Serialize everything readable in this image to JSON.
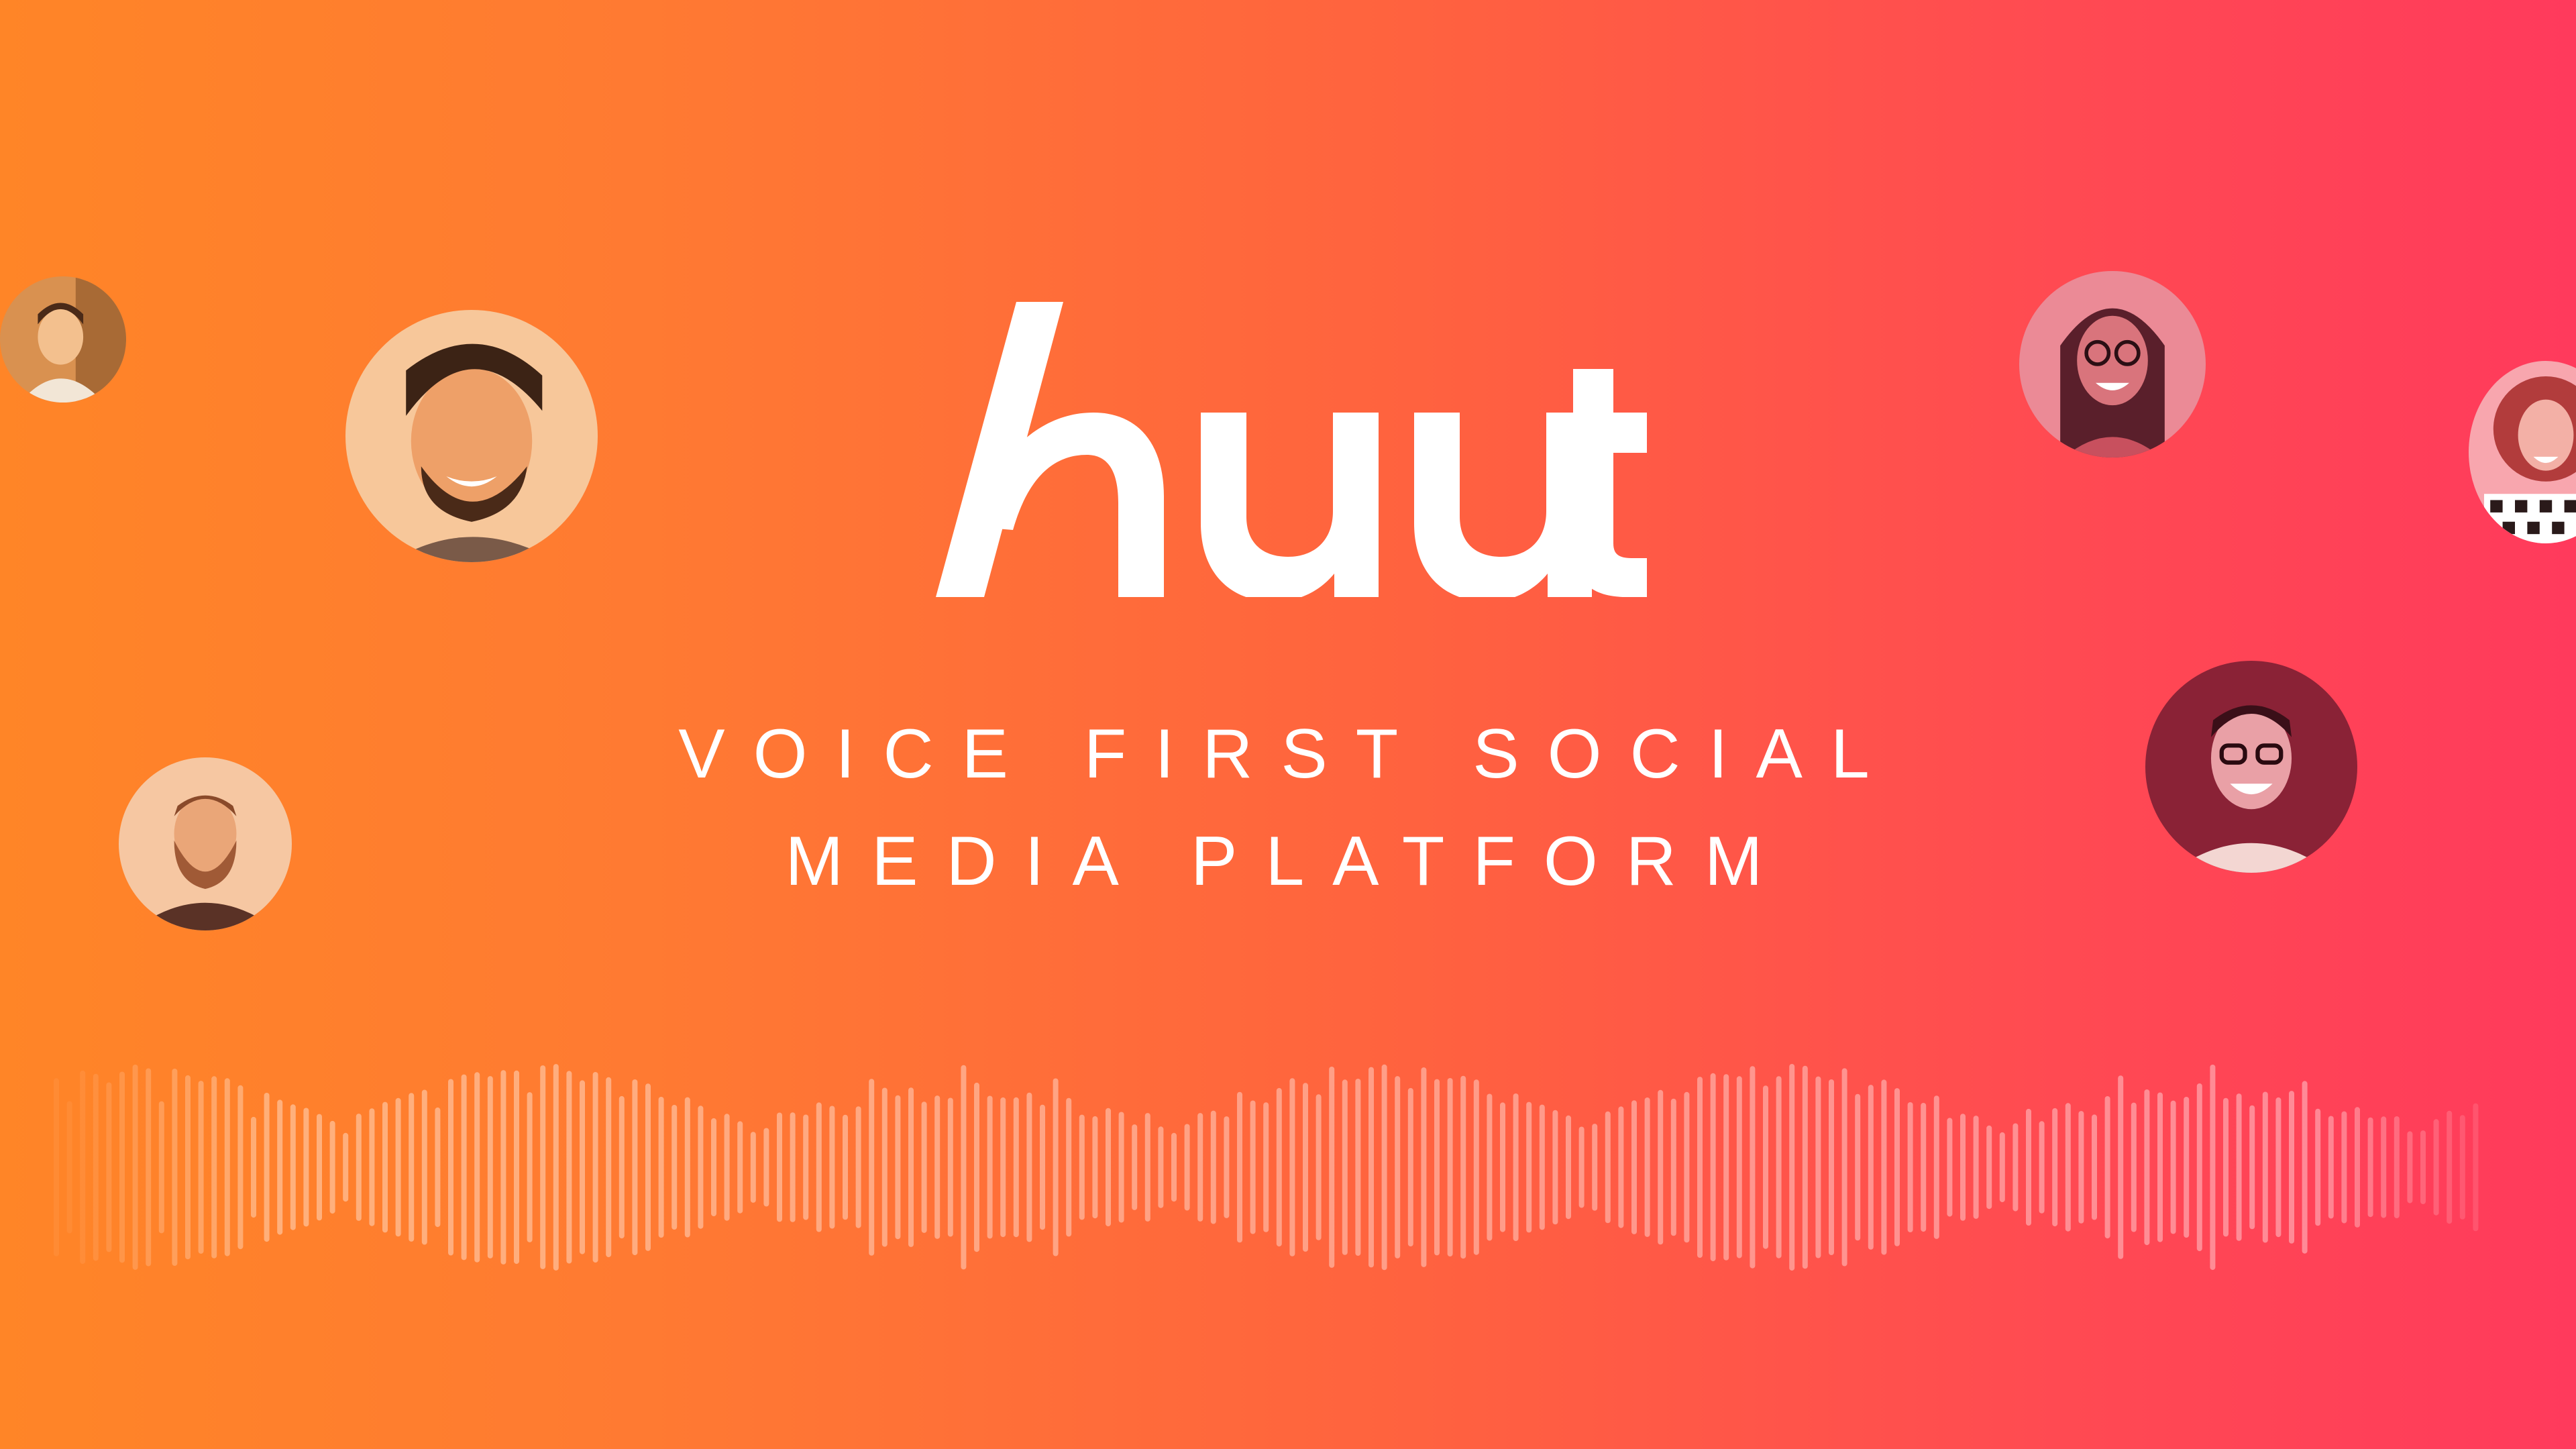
{
  "brand": {
    "logo_text": "huut"
  },
  "tagline": {
    "line1": "VOICE FIRST SOCIAL",
    "line2": "MEDIA PLATFORM"
  },
  "colors": {
    "gradient_start": "#ff8527",
    "gradient_end": "#ff3a5c",
    "text": "#ffffff"
  },
  "avatars": [
    {
      "name": "avatar-man-top-left",
      "tint": "#f0a060"
    },
    {
      "name": "avatar-man-smiling-left",
      "tint": "#f39a55"
    },
    {
      "name": "avatar-man-beard-left",
      "tint": "#f4b080"
    },
    {
      "name": "avatar-woman-glasses-right",
      "tint": "#e86070"
    },
    {
      "name": "avatar-woman-curly-right",
      "tint": "#f08090"
    },
    {
      "name": "avatar-man-glasses-right",
      "tint": "#b03045"
    }
  ]
}
